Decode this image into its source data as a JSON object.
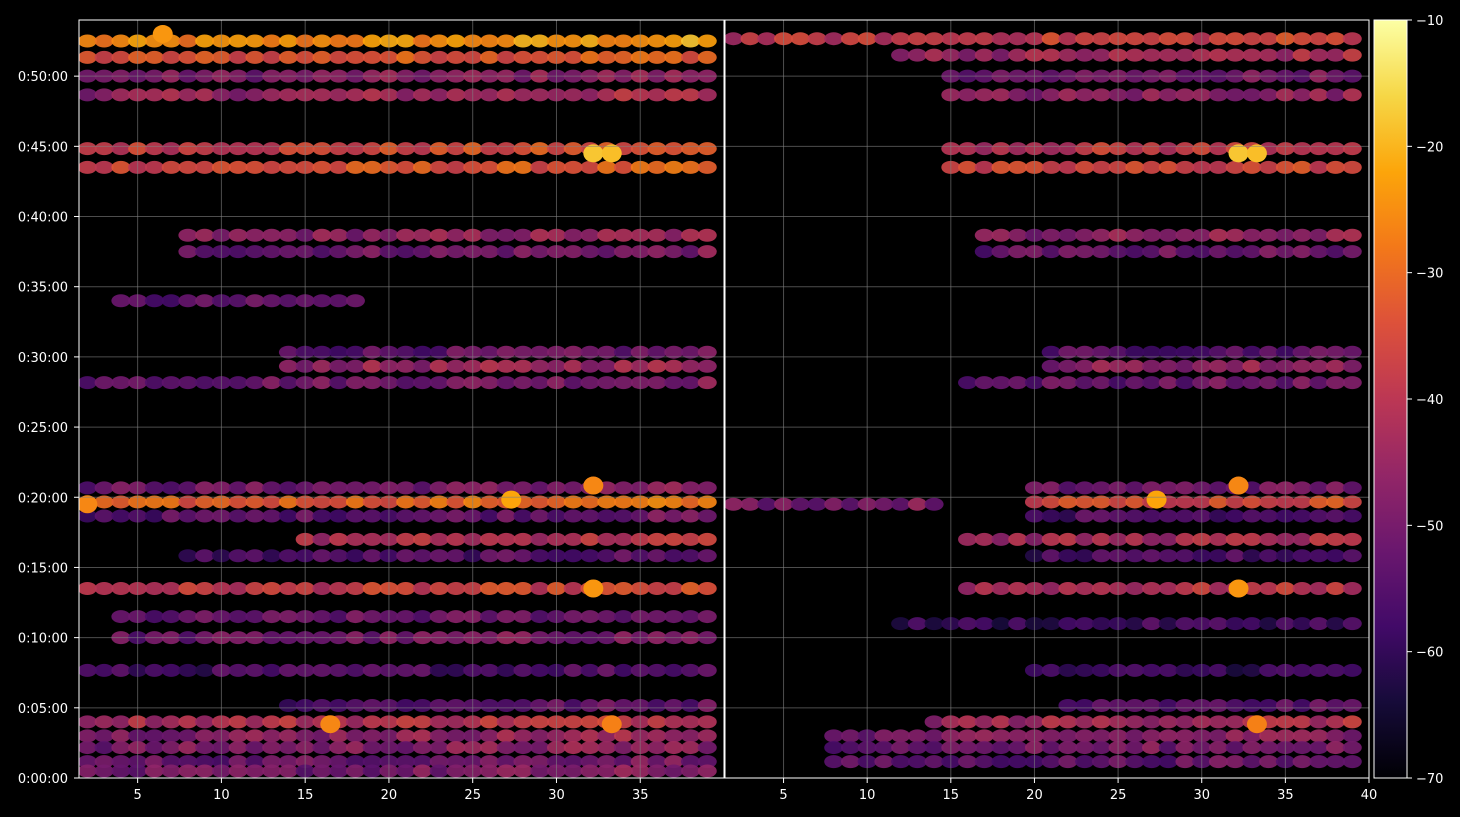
{
  "chart_data": [
    {
      "type": "heatmap",
      "panel": "left",
      "title": "",
      "xlabel": "",
      "ylabel": "",
      "xlim": [
        1.5,
        40
      ],
      "ylim_seconds": [
        0,
        3240
      ],
      "x_ticks": [
        5,
        10,
        15,
        20,
        25,
        30,
        35
      ],
      "y_ticks": [
        "0:00:00",
        "0:05:00",
        "0:10:00",
        "0:15:00",
        "0:20:00",
        "0:25:00",
        "0:30:00",
        "0:35:00",
        "0:40:00",
        "0:45:00",
        "0:50:00"
      ],
      "grid": true,
      "bands": [
        {
          "t": "0:52:30",
          "x_range": [
            2,
            39
          ],
          "level": -27
        },
        {
          "t": "0:51:20",
          "x_range": [
            2,
            39
          ],
          "level": -35
        },
        {
          "t": "0:50:00",
          "x_range": [
            2,
            39
          ],
          "level": -50
        },
        {
          "t": "0:48:40",
          "x_range": [
            2,
            39
          ],
          "level": -46
        },
        {
          "t": "0:44:50",
          "x_range": [
            2,
            39
          ],
          "level": -38
        },
        {
          "t": "0:43:30",
          "x_range": [
            2,
            39
          ],
          "level": -36
        },
        {
          "t": "0:38:40",
          "x_range": [
            8,
            39
          ],
          "level": -48
        },
        {
          "t": "0:37:30",
          "x_range": [
            8,
            39
          ],
          "level": -52
        },
        {
          "t": "0:34:00",
          "x_range": [
            4,
            18
          ],
          "level": -55
        },
        {
          "t": "0:30:20",
          "x_range": [
            14,
            39
          ],
          "level": -54
        },
        {
          "t": "0:29:20",
          "x_range": [
            14,
            39
          ],
          "level": -46
        },
        {
          "t": "0:28:10",
          "x_range": [
            2,
            39
          ],
          "level": -52
        },
        {
          "t": "0:20:40",
          "x_range": [
            2,
            39
          ],
          "level": -52
        },
        {
          "t": "0:19:40",
          "x_range": [
            2,
            39
          ],
          "level": -33
        },
        {
          "t": "0:18:40",
          "x_range": [
            2,
            39
          ],
          "level": -55
        },
        {
          "t": "0:17:00",
          "x_range": [
            15,
            39
          ],
          "level": -42
        },
        {
          "t": "0:15:50",
          "x_range": [
            8,
            39
          ],
          "level": -57
        },
        {
          "t": "0:13:30",
          "x_range": [
            2,
            39
          ],
          "level": -40
        },
        {
          "t": "0:11:30",
          "x_range": [
            4,
            39
          ],
          "level": -54
        },
        {
          "t": "0:10:00",
          "x_range": [
            4,
            39
          ],
          "level": -52
        },
        {
          "t": "0:07:40",
          "x_range": [
            2,
            39
          ],
          "level": -58
        },
        {
          "t": "0:05:10",
          "x_range": [
            14,
            39
          ],
          "level": -55
        },
        {
          "t": "0:04:00",
          "x_range": [
            2,
            39
          ],
          "level": -42
        },
        {
          "t": "0:03:00",
          "x_range": [
            2,
            39
          ],
          "level": -48
        },
        {
          "t": "0:02:10",
          "x_range": [
            2,
            39
          ],
          "level": -50
        },
        {
          "t": "0:01:10",
          "x_range": [
            2,
            39
          ],
          "level": -53
        },
        {
          "t": "0:00:30",
          "x_range": [
            2,
            39
          ],
          "level": -52
        }
      ],
      "hotspots": [
        {
          "x": 32.2,
          "t": "0:44:30",
          "level": -18
        },
        {
          "x": 33.3,
          "t": "0:44:30",
          "level": -19
        },
        {
          "x": 27.3,
          "t": "0:19:50",
          "level": -22
        },
        {
          "x": 32.2,
          "t": "0:13:30",
          "level": -24
        },
        {
          "x": 16.5,
          "t": "0:03:50",
          "level": -26
        },
        {
          "x": 33.3,
          "t": "0:03:50",
          "level": -27
        },
        {
          "x": 32.2,
          "t": "0:20:50",
          "level": -26
        },
        {
          "x": 2.0,
          "t": "0:19:30",
          "level": -26
        },
        {
          "x": 6.5,
          "t": "0:53:00",
          "level": -24
        }
      ]
    },
    {
      "type": "heatmap",
      "panel": "right",
      "title": "",
      "xlabel": "",
      "ylabel": "",
      "xlim": [
        1.5,
        40
      ],
      "ylim_seconds": [
        0,
        3240
      ],
      "x_ticks": [
        5,
        10,
        15,
        20,
        25,
        30,
        35,
        40
      ],
      "grid": true,
      "bands": [
        {
          "t": "0:52:40",
          "x_range": [
            2,
            39
          ],
          "level": -40
        },
        {
          "t": "0:51:30",
          "x_range": [
            12,
            39
          ],
          "level": -45
        },
        {
          "t": "0:50:00",
          "x_range": [
            15,
            39
          ],
          "level": -52
        },
        {
          "t": "0:48:40",
          "x_range": [
            15,
            39
          ],
          "level": -48
        },
        {
          "t": "0:44:50",
          "x_range": [
            15,
            39
          ],
          "level": -40
        },
        {
          "t": "0:43:30",
          "x_range": [
            15,
            39
          ],
          "level": -38
        },
        {
          "t": "0:38:40",
          "x_range": [
            17,
            39
          ],
          "level": -48
        },
        {
          "t": "0:37:30",
          "x_range": [
            17,
            39
          ],
          "level": -53
        },
        {
          "t": "0:30:20",
          "x_range": [
            21,
            39
          ],
          "level": -55
        },
        {
          "t": "0:29:20",
          "x_range": [
            21,
            39
          ],
          "level": -47
        },
        {
          "t": "0:28:10",
          "x_range": [
            16,
            39
          ],
          "level": -53
        },
        {
          "t": "0:20:40",
          "x_range": [
            20,
            39
          ],
          "level": -52
        },
        {
          "t": "0:19:40",
          "x_range": [
            20,
            39
          ],
          "level": -36
        },
        {
          "t": "0:19:30",
          "x_range": [
            2,
            14
          ],
          "level": -50
        },
        {
          "t": "0:18:40",
          "x_range": [
            20,
            39
          ],
          "level": -56
        },
        {
          "t": "0:17:00",
          "x_range": [
            16,
            39
          ],
          "level": -44
        },
        {
          "t": "0:15:50",
          "x_range": [
            20,
            39
          ],
          "level": -58
        },
        {
          "t": "0:13:30",
          "x_range": [
            16,
            39
          ],
          "level": -42
        },
        {
          "t": "0:11:00",
          "x_range": [
            12,
            39
          ],
          "level": -60
        },
        {
          "t": "0:07:40",
          "x_range": [
            20,
            39
          ],
          "level": -60
        },
        {
          "t": "0:05:10",
          "x_range": [
            22,
            39
          ],
          "level": -56
        },
        {
          "t": "0:04:00",
          "x_range": [
            14,
            39
          ],
          "level": -44
        },
        {
          "t": "0:03:00",
          "x_range": [
            8,
            39
          ],
          "level": -50
        },
        {
          "t": "0:02:10",
          "x_range": [
            8,
            39
          ],
          "level": -52
        },
        {
          "t": "0:01:10",
          "x_range": [
            8,
            39
          ],
          "level": -55
        }
      ],
      "hotspots": [
        {
          "x": 32.2,
          "t": "0:44:30",
          "level": -18
        },
        {
          "x": 33.3,
          "t": "0:44:30",
          "level": -19
        },
        {
          "x": 27.3,
          "t": "0:19:50",
          "level": -22
        },
        {
          "x": 32.2,
          "t": "0:13:30",
          "level": -24
        },
        {
          "x": 33.3,
          "t": "0:03:50",
          "level": -27
        },
        {
          "x": 32.2,
          "t": "0:20:50",
          "level": -26
        }
      ]
    }
  ],
  "colorbar": {
    "colormap": "inferno",
    "min": -70,
    "max": -10,
    "ticks": [
      "−10",
      "−20",
      "−30",
      "−40",
      "−50",
      "−60",
      "−70"
    ]
  },
  "colors": {
    "background": "#000000",
    "axes": "#ffffff",
    "grid": "#808080"
  }
}
